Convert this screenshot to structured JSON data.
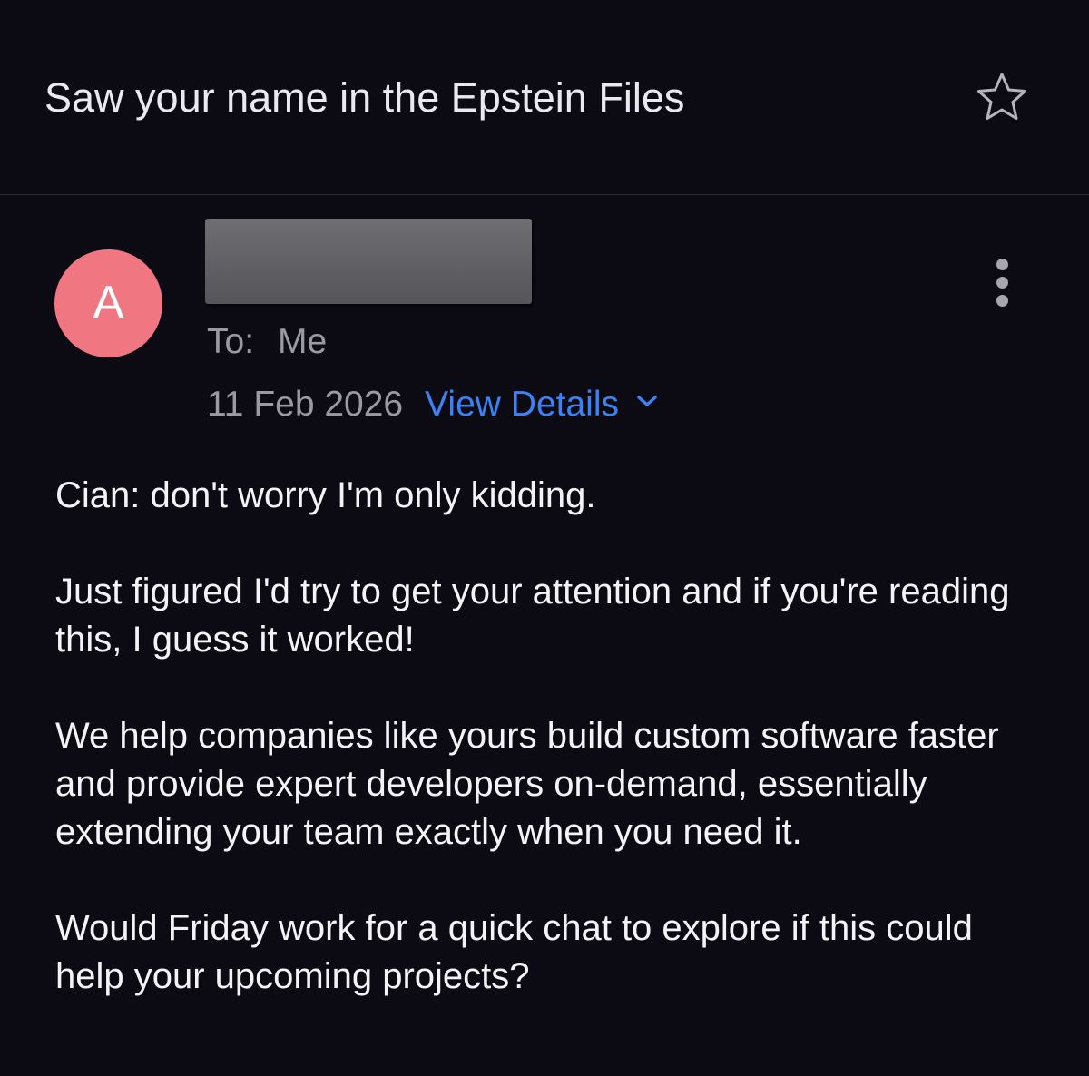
{
  "subject": "Saw your name in the Epstein Files",
  "icons": {
    "star": "star-outline-icon",
    "more": "vertical-ellipsis-icon",
    "chevron": "chevron-down-icon"
  },
  "colors": {
    "background": "#0c0b13",
    "avatar": "#f07782",
    "link": "#3b82f6",
    "muted_text": "#9a9aa2"
  },
  "sender": {
    "avatar_letter": "A"
  },
  "recipient": {
    "label": "To:",
    "value": "Me"
  },
  "meta": {
    "date": "11 Feb 2026",
    "view_details": "View Details"
  },
  "body": {
    "paragraphs": [
      "Cian: don't worry I'm only kidding.",
      "Just figured I'd try to get your attention and if you're reading this, I guess it worked!",
      "We help companies like yours build custom software faster and provide expert developers on-demand, essentially extending your team exactly when you need it.",
      "Would Friday work for a quick chat to explore if this could help your upcoming projects?"
    ]
  }
}
